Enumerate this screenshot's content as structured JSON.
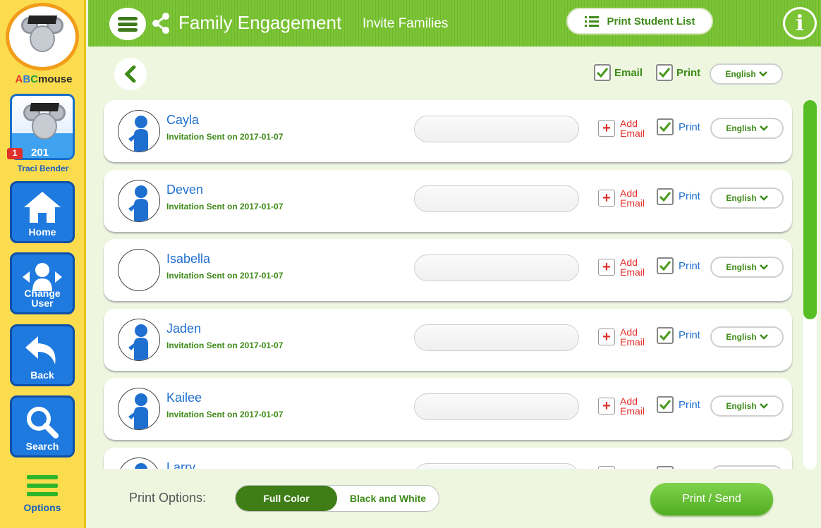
{
  "sidebar": {
    "brand": {
      "a": "A",
      "b": "B",
      "c": "C",
      "rest": "mouse"
    },
    "user": {
      "level": "1",
      "count": "201",
      "name": "Traci Bender"
    },
    "buttons": {
      "home": "Home",
      "change_user_1": "Change",
      "change_user_2": "User",
      "back": "Back",
      "search": "Search"
    },
    "options": "Options"
  },
  "header": {
    "title": "Family Engagement",
    "subtitle": "Invite Families",
    "print_list": "Print Student List"
  },
  "top_controls": {
    "email": "Email",
    "print": "Print",
    "language": "English"
  },
  "students": [
    {
      "name": "Cayla",
      "status": "Invitation Sent on 2017-01-07",
      "add_email_1": "Add",
      "add_email_2": "Email",
      "print": "Print",
      "language": "English",
      "has_avatar": true
    },
    {
      "name": "Deven",
      "status": "Invitation Sent on 2017-01-07",
      "add_email_1": "Add",
      "add_email_2": "Email",
      "print": "Print",
      "language": "English",
      "has_avatar": true
    },
    {
      "name": "Isabella",
      "status": "Invitation Sent on 2017-01-07",
      "add_email_1": "Add",
      "add_email_2": "Email",
      "print": "Print",
      "language": "English",
      "has_avatar": false
    },
    {
      "name": "Jaden",
      "status": "Invitation Sent on 2017-01-07",
      "add_email_1": "Add",
      "add_email_2": "Email",
      "print": "Print",
      "language": "English",
      "has_avatar": true
    },
    {
      "name": "Kailee",
      "status": "Invitation Sent on 2017-01-07",
      "add_email_1": "Add",
      "add_email_2": "Email",
      "print": "Print",
      "language": "English",
      "has_avatar": true
    },
    {
      "name": "Larry",
      "status": "",
      "add_email_1": "",
      "add_email_2": "",
      "print": "",
      "language": "",
      "has_avatar": true
    }
  ],
  "footer": {
    "print_options_label": "Print Options:",
    "full_color": "Full Color",
    "black_white": "Black and White",
    "print_send": "Print / Send"
  },
  "colors": {
    "header_green": "#7cc436",
    "sidebar_yellow": "#fbdc4f",
    "button_blue": "#1f7ae0",
    "accent_green": "#3d8a18",
    "name_blue": "#1f6fd1"
  }
}
